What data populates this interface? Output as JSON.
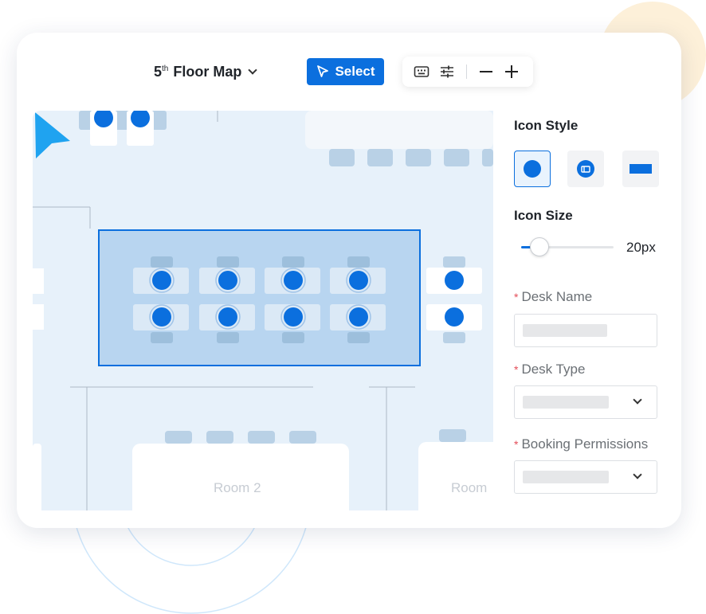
{
  "toolbar": {
    "floor_prefix": "5",
    "floor_suffix": "th",
    "floor_label": "Floor Map",
    "select_label": "Select",
    "tools": [
      "keyboard-icon",
      "sliders-icon",
      "zoom-out-icon",
      "zoom-in-icon"
    ]
  },
  "map": {
    "rooms": [
      "Room 2",
      "Room"
    ],
    "colors": {
      "desk_marker": "#0b6fde",
      "selection_fill": "#b8d5f0",
      "selection_border": "#0b6fde",
      "cursor": "#1fa3f0"
    }
  },
  "panel": {
    "icon_style_title": "Icon Style",
    "icon_styles": [
      "circle-marker-icon",
      "desk-badge-icon",
      "rectangle-marker-icon"
    ],
    "icon_size_title": "Icon Size",
    "icon_size_value": "20px",
    "icon_size_fraction": 0.2,
    "desk_name_label": "Desk Name",
    "desk_type_label": "Desk Type",
    "booking_permissions_label": "Booking Permissions",
    "required_mark": "*"
  }
}
